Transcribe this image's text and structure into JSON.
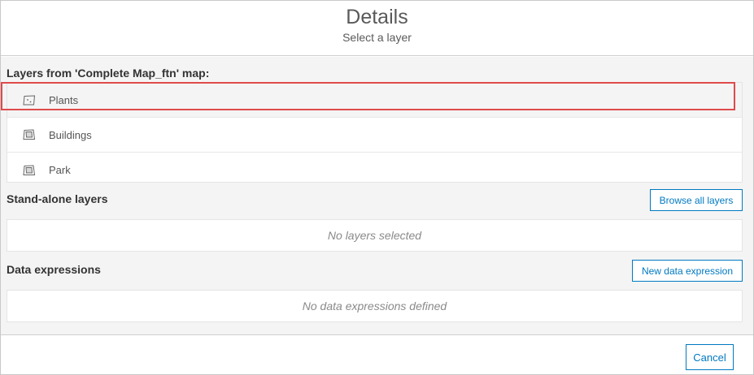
{
  "header": {
    "title": "Details",
    "subtitle": "Select a layer"
  },
  "map_layers": {
    "title": "Layers from 'Complete Map_ftn' map:",
    "items": [
      {
        "label": "Plants",
        "icon": "polygon-layer-icon",
        "selected": true
      },
      {
        "label": "Buildings",
        "icon": "map-layer-icon"
      },
      {
        "label": "Park",
        "icon": "map-layer-icon"
      }
    ]
  },
  "standalone": {
    "title": "Stand-alone layers",
    "browse_label": "Browse all layers",
    "empty_text": "No layers selected"
  },
  "expressions": {
    "title": "Data expressions",
    "new_label": "New data expression",
    "empty_text": "No data expressions defined"
  },
  "footer": {
    "cancel_label": "Cancel"
  },
  "colors": {
    "accent": "#0079c1",
    "highlight": "#e04a4a",
    "panel_bg": "#f4f4f4"
  }
}
